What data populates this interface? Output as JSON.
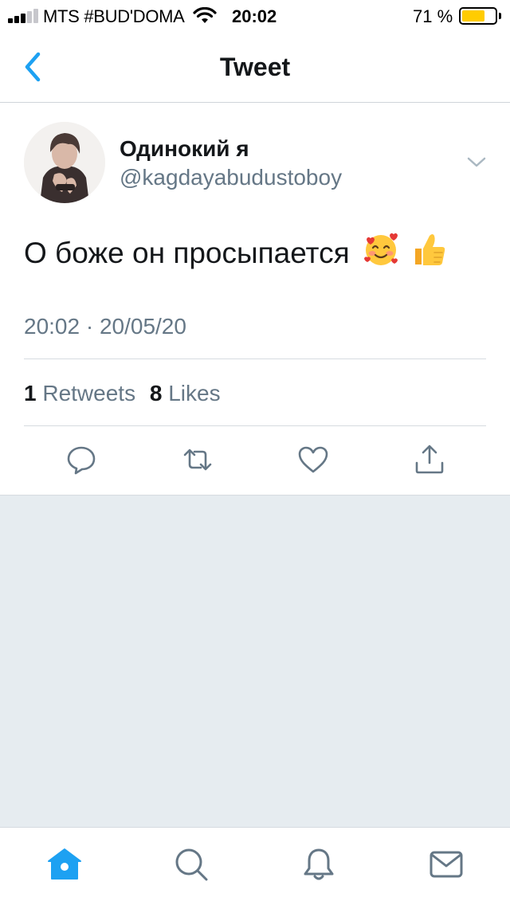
{
  "status_bar": {
    "carrier": "MTS #BUD'DOMA",
    "time": "20:02",
    "battery_percent": "71 %",
    "battery_level": 0.71,
    "battery_color": "#ffcc00"
  },
  "nav": {
    "title": "Tweet",
    "back_icon": "chevron-left-icon",
    "accent_color": "#1da1f2"
  },
  "tweet": {
    "author": {
      "display_name": "Одинокий я",
      "handle": "@kagdayabudustoboy"
    },
    "text": "О боже он просыпается",
    "emojis": [
      "smiling-face-with-hearts",
      "thumbs-up"
    ],
    "timestamp": "20:02 · 20/05/20",
    "stats": {
      "retweets_count": "1",
      "retweets_label": "Retweets",
      "likes_count": "8",
      "likes_label": "Likes"
    },
    "actions": [
      "reply-icon",
      "retweet-icon",
      "like-icon",
      "share-icon"
    ]
  },
  "tab_bar": {
    "tabs": [
      "home-icon",
      "search-icon",
      "notifications-icon",
      "messages-icon"
    ],
    "active": "home-icon"
  },
  "colors": {
    "text_primary": "#14171a",
    "text_secondary": "#657786",
    "background": "#e6ecf0"
  }
}
